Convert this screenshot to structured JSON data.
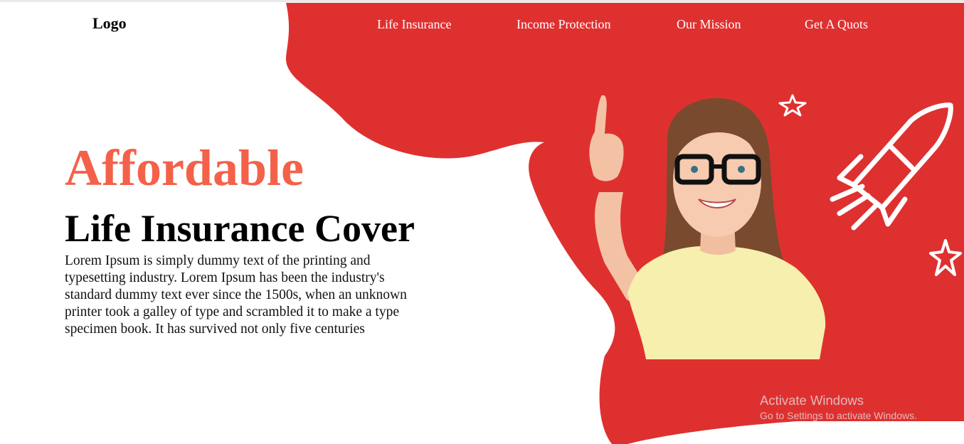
{
  "header": {
    "logo": "Logo",
    "nav": [
      "Life Insurance",
      "Income Protection",
      "Our Mission",
      "Get A Quots"
    ]
  },
  "hero": {
    "accent": "Affordable",
    "title": "Life Insurance Cover",
    "body": "Lorem Ipsum is simply dummy text of the printing and typesetting industry. Lorem Ipsum has been the industry's standard dummy text ever since the 1500s, when an unknown printer took a galley of type and scrambled it to make a type specimen book. It has survived not only five centuries"
  },
  "watermark": {
    "title": "Activate Windows",
    "subtitle": "Go to Settings to activate Windows."
  },
  "colors": {
    "brand_red": "#df3030",
    "accent": "#f4614a"
  },
  "icons": [
    "rocket-icon",
    "star-icon"
  ]
}
